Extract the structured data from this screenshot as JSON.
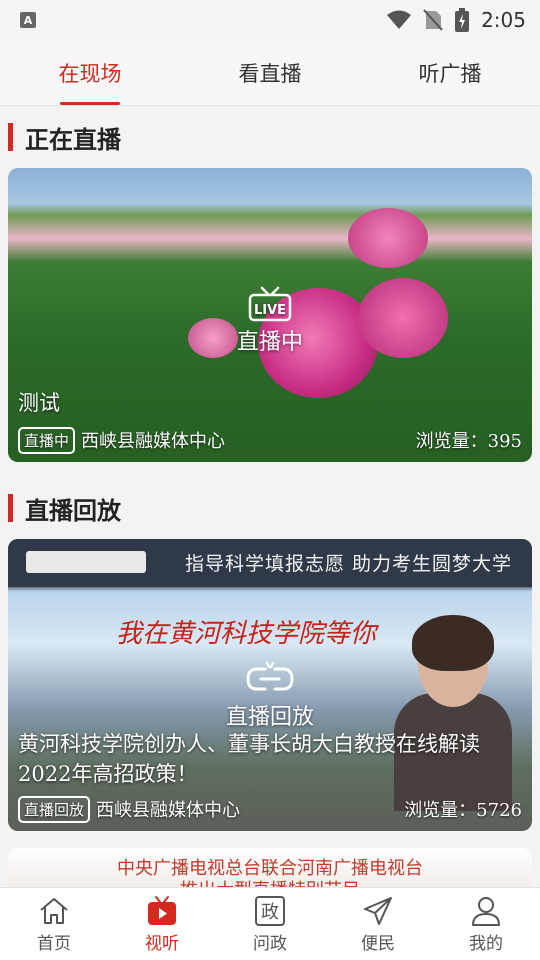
{
  "status_bar": {
    "time": "2:05",
    "notification_icon": "A"
  },
  "tabs": [
    {
      "label": "在现场",
      "active": true
    },
    {
      "label": "看直播",
      "active": false
    },
    {
      "label": "听广播",
      "active": false
    }
  ],
  "live_section": {
    "title": "正在直播",
    "card": {
      "overlay_icon_text": "LIVE",
      "overlay_label": "直播中",
      "title": "测试",
      "badge": "直播中",
      "source": "西峡县融媒体中心",
      "views": "浏览量：395"
    }
  },
  "replay_section": {
    "title": "直播回放",
    "card": {
      "banner_text": "指导科学填报志愿 助力考生圆梦大学",
      "calligraphy": "我在黄河科技学院等你",
      "overlay_label": "直播回放",
      "title": "黄河科技学院创办人、董事长胡大白教授在线解读2022年高招政策！",
      "badge": "直播回放",
      "source": "西峡县融媒体中心",
      "views": "浏览量：5726"
    },
    "next_card": {
      "line1": "中央广播电视总台联合河南广播电视台",
      "line2": "推出大型直播特别节目"
    }
  },
  "bottom_nav": [
    {
      "label": "首页",
      "icon": "home-icon",
      "active": false
    },
    {
      "label": "视听",
      "icon": "video-icon",
      "active": true
    },
    {
      "label": "问政",
      "icon": "zheng-icon",
      "glyph": "政",
      "active": false
    },
    {
      "label": "便民",
      "icon": "send-icon",
      "active": false
    },
    {
      "label": "我的",
      "icon": "user-icon",
      "active": false
    }
  ],
  "colors": {
    "accent": "#d22a1e"
  }
}
